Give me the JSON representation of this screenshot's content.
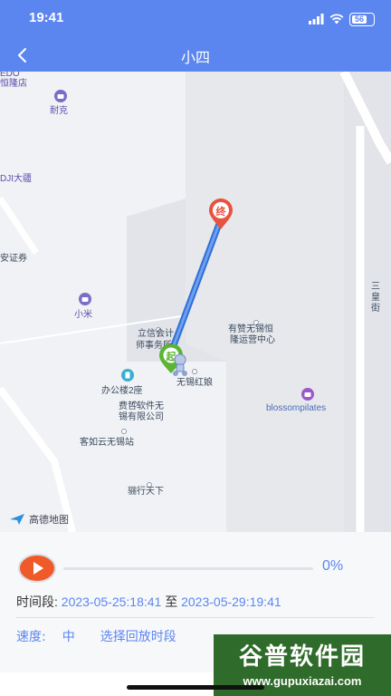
{
  "status_bar": {
    "time": "19:41",
    "battery": "56"
  },
  "header": {
    "title": "小四"
  },
  "map": {
    "pois": [
      {
        "id": "edo",
        "label": "EDO"
      },
      {
        "id": "henglong",
        "label": "恒隆店"
      },
      {
        "id": "nike",
        "label": "耐克"
      },
      {
        "id": "dji",
        "label": "DJI大疆"
      },
      {
        "id": "anzheng",
        "label": "安证券"
      },
      {
        "id": "xiaomi",
        "label": "小米"
      },
      {
        "id": "lixin1",
        "label": "立信会计"
      },
      {
        "id": "lixin2",
        "label": "师事务所"
      },
      {
        "id": "youzan1",
        "label": "有赞无锡恒"
      },
      {
        "id": "youzan2",
        "label": "隆运营中心"
      },
      {
        "id": "office",
        "label": "办公楼2座"
      },
      {
        "id": "hongniang",
        "label": "无锡红娘"
      },
      {
        "id": "blossom",
        "label": "blossompilates"
      },
      {
        "id": "feizhe1",
        "label": "费哲软件无"
      },
      {
        "id": "feizhe2",
        "label": "锡有限公司"
      },
      {
        "id": "kerunyun",
        "label": "客如云无锡站"
      },
      {
        "id": "tiexia",
        "label": "骊行天下"
      },
      {
        "id": "sanhuang1",
        "label": "三"
      },
      {
        "id": "sanhuang2",
        "label": "皇"
      },
      {
        "id": "sanhuang3",
        "label": "街"
      }
    ],
    "end_marker": "终",
    "start_marker": "起",
    "logo_label": "高德地图",
    "route_color": "#4a86e8"
  },
  "playback": {
    "progress": 0,
    "percent_label": "0%",
    "time_label": "时间段:",
    "start_time": "2023-05-25:18:41",
    "to_label": "至",
    "end_time": "2023-05-29:19:41",
    "speed_label": "速度:",
    "speed_value": "中",
    "select_label": "选择回放时段"
  },
  "watermark": {
    "title": "谷普软件园",
    "url": "www.gupuxiazai.com"
  },
  "colors": {
    "accent": "#5b86f0",
    "play": "#f05a28"
  }
}
